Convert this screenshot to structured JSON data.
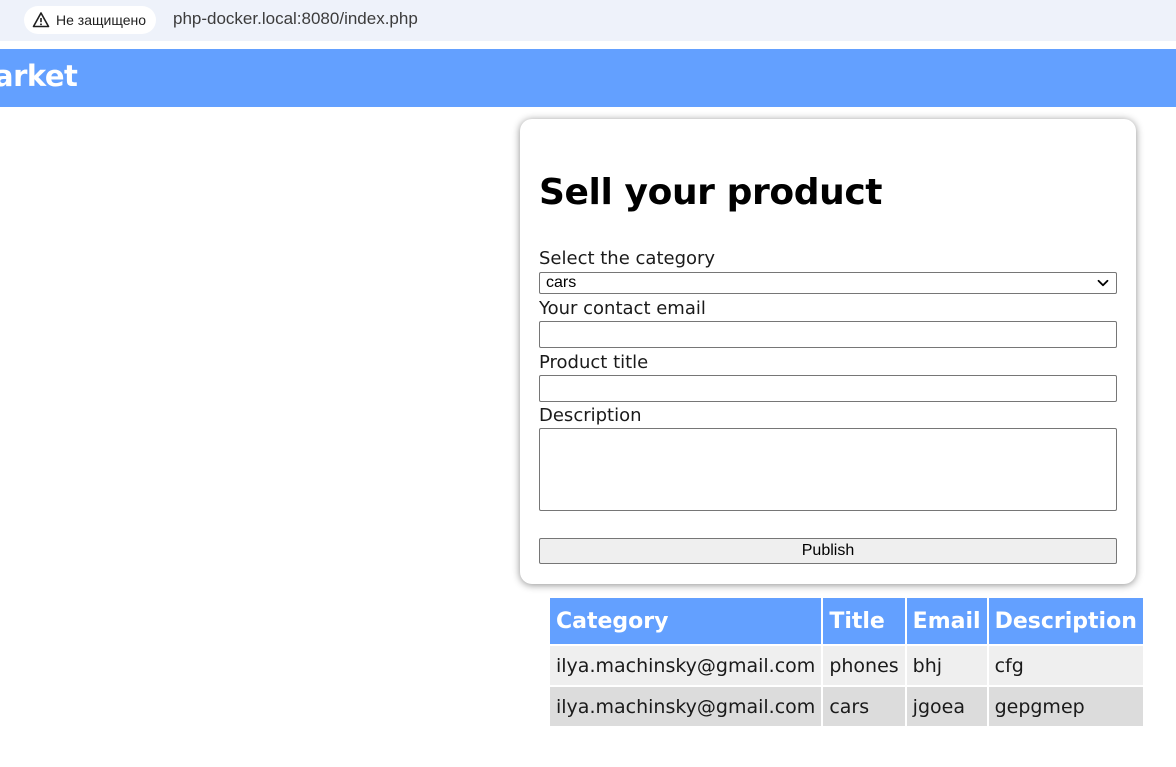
{
  "browser": {
    "security_label": "Не защищено",
    "url": "php-docker.local:8080/index.php"
  },
  "header": {
    "logo": "arket",
    "background": "#63a0ff"
  },
  "form": {
    "title": "Sell your product",
    "category_label": "Select the category",
    "category_value": "cars",
    "email_label": "Your contact email",
    "email_value": "",
    "title_label": "Product title",
    "title_value": "",
    "description_label": "Description",
    "description_value": "",
    "publish_label": "Publish"
  },
  "table": {
    "headers": [
      "Category",
      "Title",
      "Email",
      "Description"
    ],
    "rows": [
      [
        "ilya.machinsky@gmail.com",
        "phones",
        "bhj",
        "cfg"
      ],
      [
        "ilya.machinsky@gmail.com",
        "cars",
        "jgoea",
        "gepgmep"
      ]
    ]
  }
}
